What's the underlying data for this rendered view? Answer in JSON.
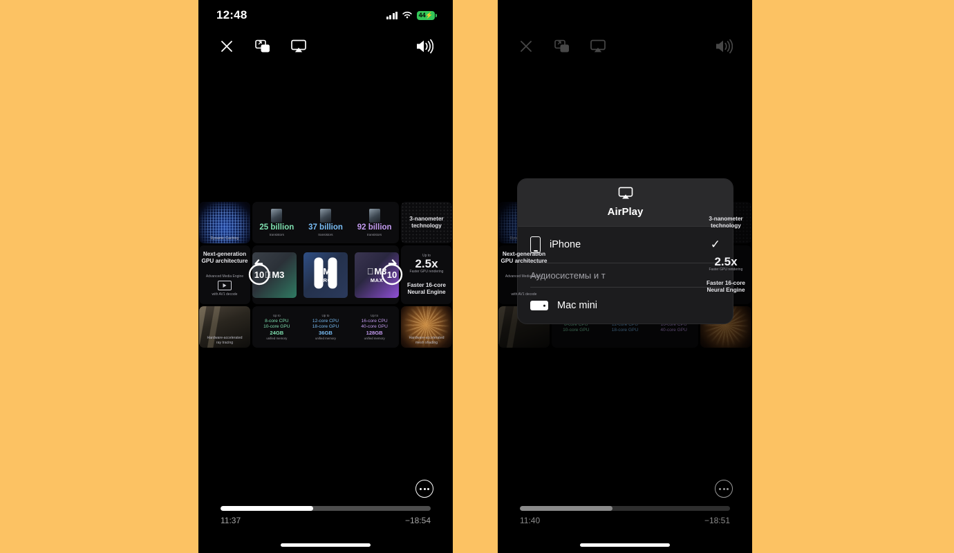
{
  "background_color": "#FCC263",
  "left_panel": {
    "name": "video-player-screen",
    "status_bar": {
      "time": "12:48",
      "cellular_icon": "cellular-signal-icon",
      "wifi_icon": "wifi-icon",
      "battery_percent": "44",
      "battery_charging_icon": "lightning-bolt-icon",
      "battery_color": "#34C759"
    },
    "top_controls": [
      {
        "name": "close-button",
        "icon": "close-icon"
      },
      {
        "name": "picture-in-picture-button",
        "icon": "picture-in-picture-icon"
      },
      {
        "name": "airplay-button",
        "icon": "airplay-icon"
      },
      {
        "name": "volume-button",
        "icon": "volume-high-icon"
      }
    ],
    "transport": {
      "skip_back_label": "10",
      "skip_forward_label": "10",
      "play_state_icon": "pause-icon"
    },
    "more_button_icon": "ellipsis-circle-icon",
    "scrubber": {
      "progress_percent": 44,
      "elapsed": "11:37",
      "remaining": "−18:54"
    },
    "home_indicator": "home-indicator"
  },
  "right_panel": {
    "name": "airplay-picker-screen",
    "top_controls": [
      {
        "name": "close-button",
        "icon": "close-icon"
      },
      {
        "name": "picture-in-picture-button",
        "icon": "picture-in-picture-icon"
      },
      {
        "name": "airplay-button",
        "icon": "airplay-icon"
      },
      {
        "name": "volume-button",
        "icon": "volume-high-icon"
      }
    ],
    "airplay_sheet": {
      "header_icon": "airplay-icon",
      "title": "AirPlay",
      "rows": [
        {
          "name": "device-row-iphone",
          "icon": "iphone-icon",
          "label": "iPhone",
          "selected": true,
          "check_icon": "checkmark-icon"
        }
      ],
      "section_header": "Аудиосистемы и т",
      "speaker_rows": [
        {
          "name": "device-row-mac-mini",
          "icon": "mac-mini-icon",
          "label": "Mac mini",
          "selected": false
        }
      ]
    },
    "more_button_icon": "ellipsis-circle-icon",
    "scrubber": {
      "progress_percent": 44,
      "elapsed": "11:40",
      "remaining": "−18:51"
    },
    "home_indicator": "home-indicator"
  },
  "video_content": {
    "description": "Apple M3 chip family keynote grid",
    "tiles": {
      "dynamic_caching": "Dynamic Caching",
      "transistors": [
        {
          "count": "25 billion",
          "label": "transistors",
          "color": "#7fe0b0"
        },
        {
          "count": "37 billion",
          "label": "transistors",
          "color": "#79bdf5"
        },
        {
          "count": "92 billion",
          "label": "transistors",
          "color": "#c39bf0"
        }
      ],
      "nanometer_title": "3-nanometer",
      "nanometer_sub": "technology",
      "gpu_arch_line1": "Next-generation",
      "gpu_arch_line2": "GPU architecture",
      "media_engine_title": "Advanced Media Engine",
      "media_engine_sub": "with AV1 decode",
      "chips": [
        {
          "brand": "M3",
          "suffix": ""
        },
        {
          "brand": "M3",
          "suffix": "PRO"
        },
        {
          "brand": "M3",
          "suffix": "MAX"
        }
      ],
      "upto_label": "Up to",
      "speed_value": "2.5x",
      "speed_caption": "Faster GPU rendering",
      "neural_line1": "Faster 16-core",
      "neural_line2": "Neural Engine",
      "specs": [
        {
          "cpu": "8-core CPU",
          "gpu": "10-core GPU",
          "memory": "24GB",
          "memory_sub": "unified memory",
          "color": "#7fe0b0"
        },
        {
          "cpu": "12-core CPU",
          "gpu": "18-core GPU",
          "memory": "36GB",
          "memory_sub": "unified memory",
          "color": "#79bdf5"
        },
        {
          "cpu": "16-core CPU",
          "gpu": "40-core GPU",
          "memory": "128GB",
          "memory_sub": "unified memory",
          "color": "#c39bf0"
        }
      ],
      "ray_tracing_line1": "Hardware-accelerated",
      "ray_tracing_line2": "ray tracing",
      "mesh_shading_line1": "Hardware-accelerated",
      "mesh_shading_line2": "mesh shading"
    }
  },
  "annotations": [
    {
      "name": "arrow-pointing-to-airplay-button",
      "color": "#C0392B",
      "direction": "up-left"
    },
    {
      "name": "arrow-pointing-to-device-list",
      "color": "#C0392B",
      "direction": "down-right"
    }
  ]
}
